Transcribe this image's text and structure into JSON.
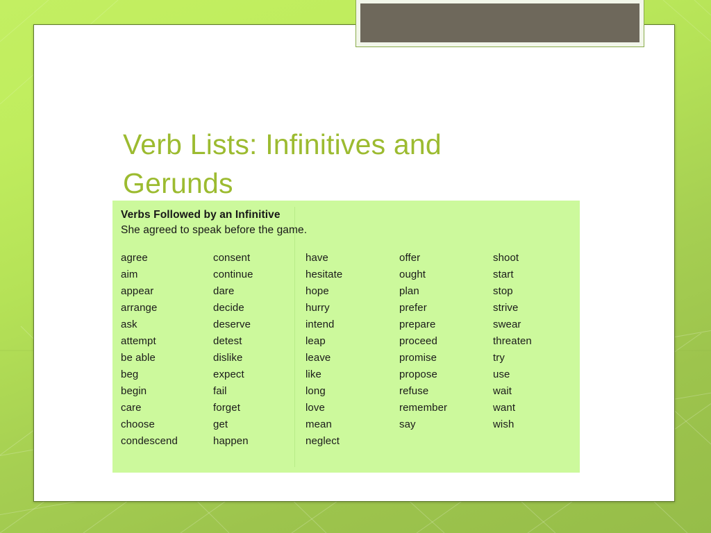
{
  "slide": {
    "title": "Verb Lists: Infinitives and Gerunds",
    "title_color": "#9cbb30",
    "background_color": "#b5e257",
    "card_color": "#ffffff",
    "banner_color": "#6e685b"
  },
  "panel": {
    "background_color": "#ccf99c",
    "heading": "Verbs Followed by an Infinitive",
    "example": "She agreed to speak before the game.",
    "columns": [
      {
        "index": 1,
        "items": [
          "agree",
          "aim",
          "appear",
          "arrange",
          "ask",
          "attempt",
          "be able",
          "beg",
          "begin",
          "care",
          "choose",
          "condescend"
        ]
      },
      {
        "index": 2,
        "items": [
          "consent",
          "continue",
          "dare",
          "decide",
          "deserve",
          "detest",
          "dislike",
          "expect",
          "fail",
          "forget",
          "get",
          "happen"
        ]
      },
      {
        "index": 3,
        "items": [
          "have",
          "hesitate",
          "hope",
          "hurry",
          "intend",
          "leap",
          "leave",
          "like",
          "long",
          "love",
          "mean",
          "neglect"
        ]
      },
      {
        "index": 4,
        "items": [
          "offer",
          "ought",
          "plan",
          "prefer",
          "prepare",
          "proceed",
          "promise",
          "propose",
          "refuse",
          "remember",
          "say"
        ]
      },
      {
        "index": 5,
        "items": [
          "shoot",
          "start",
          "stop",
          "strive",
          "swear",
          "threaten",
          "try",
          "use",
          "wait",
          "want",
          "wish"
        ]
      }
    ]
  }
}
